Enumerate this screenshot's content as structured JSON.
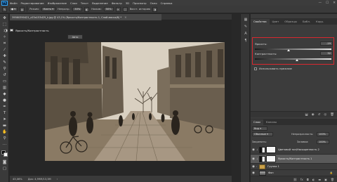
{
  "app": {
    "logo": "Ps",
    "menu": [
      "Файл",
      "Редактирование",
      "Изображение",
      "Слои",
      "Текст",
      "Выделение",
      "Фильтр",
      "3D",
      "Просмотр",
      "Окно",
      "Справка"
    ],
    "window_controls": [
      "—",
      "☐",
      "✕"
    ]
  },
  "options_bar": {
    "mode_label": "Режим:",
    "mode_value": "Кисть",
    "opacity_label": "Непрозр.:",
    "opacity_value": "30%",
    "pressure_label": "Нажим:",
    "pressure_value": "50%",
    "erase_history_label": "Восст. историю"
  },
  "document": {
    "tab_title": "39560390421_c03a153d29_k.jpg @ 43,1% (Яркость/Контрастность 1, Слой-маска/8) *",
    "close_glyph": "×"
  },
  "status": {
    "zoom": "43,06%",
    "doc_size": "Док: 4,99M/13,3M"
  },
  "panels": {
    "properties_tabs": [
      "Свойства",
      "Цвет",
      "Образцы",
      "Библ.",
      "Корр."
    ],
    "adjustment_title": "Яркость/Контрастность",
    "auto_button": "Авто",
    "brightness_label": "Яркость:",
    "brightness_value": "-19",
    "contrast_label": "Контрастность:",
    "contrast_value": "32",
    "brightness_level": -19,
    "brightness_range": [
      -150,
      150
    ],
    "contrast_level": 32,
    "contrast_range": [
      -50,
      100
    ],
    "use_legacy_label": "Использовать прежние",
    "layers_tabs": [
      "Слои",
      "Каналы"
    ],
    "kind_filter": "Вид",
    "blend_mode": "Обычные",
    "opacity_label": "Непрозрачность:",
    "opacity_value": "100%",
    "lock_label": "Закрепить:",
    "fill_label": "Заливка:",
    "fill_value": "100%"
  },
  "layers": [
    {
      "name": "Цветовой тон/Насыщенность 2",
      "type": "adjustment",
      "selected": false
    },
    {
      "name": "Яркость/Контрастность 1",
      "type": "adjustment",
      "selected": true
    },
    {
      "name": "Группа 1",
      "type": "group",
      "selected": false
    },
    {
      "name": "Фон",
      "type": "image",
      "selected": false
    }
  ],
  "colors": {
    "highlight": "#d9282f",
    "accent": "#31a8ff",
    "selected_row": "#5a5a5a"
  }
}
